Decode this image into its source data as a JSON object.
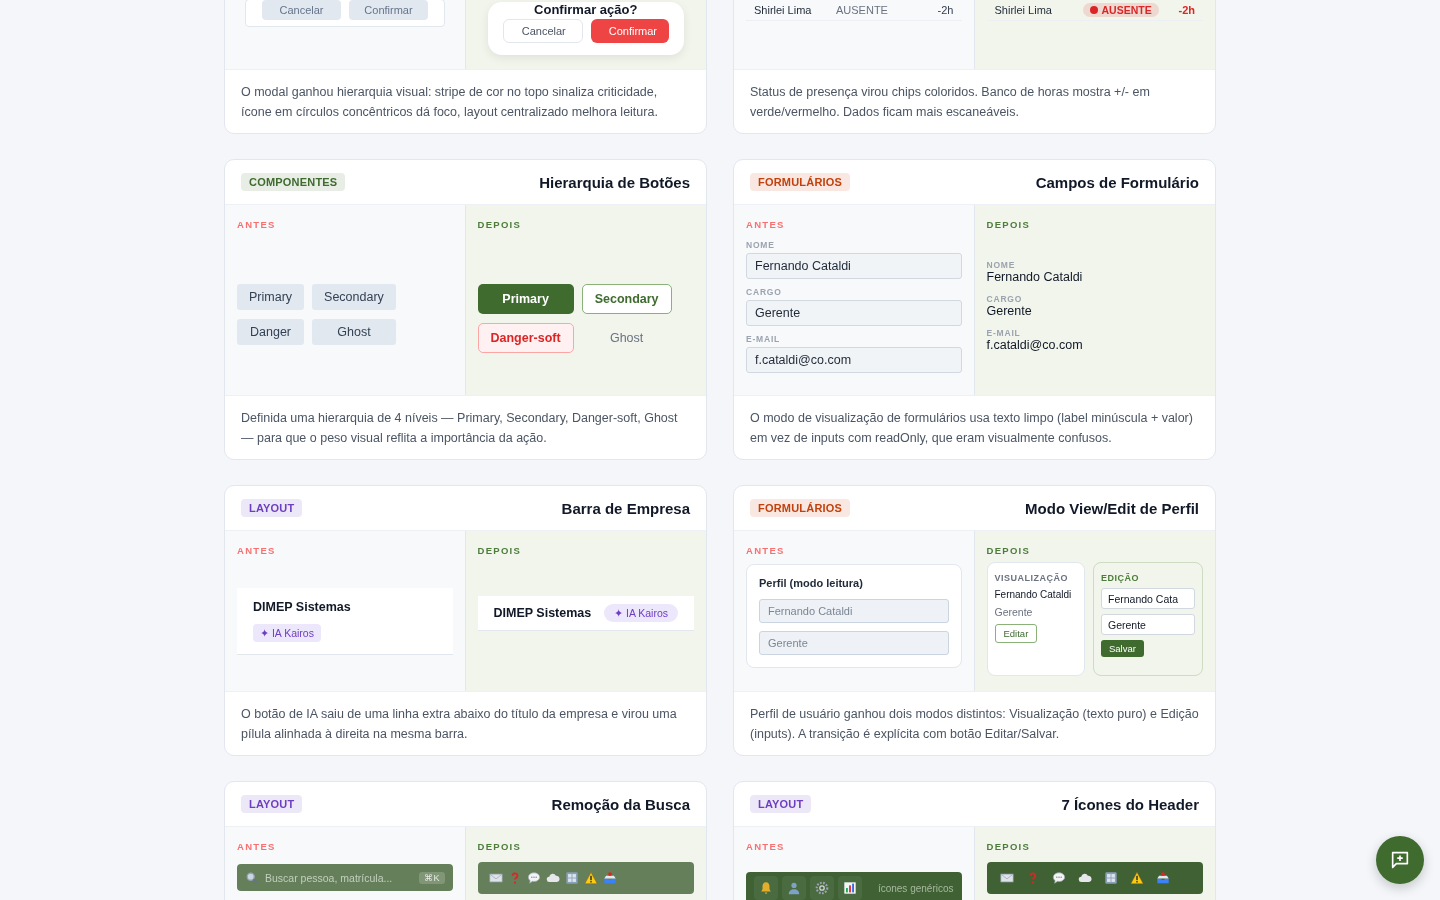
{
  "cards": [
    {
      "kind": "modal",
      "before": {
        "buttons": [
          "Cancelar",
          "Confirmar"
        ]
      },
      "after": {
        "title": "Confirmar ação?",
        "buttons": [
          {
            "text": "Cancelar",
            "kind": "outline"
          },
          {
            "text": "Confirmar",
            "kind": "danger"
          }
        ]
      },
      "description": "O modal ganhou hierarquia visual: stripe de cor no topo sinaliza criticidade, ícone em círculos concêntricos dá foco, layout centralizado melhora leitura."
    },
    {
      "kind": "presence",
      "before": {
        "rows": [
          {
            "name": "Shirlei Lima",
            "status": "AUSENTE",
            "hours": "-2h"
          }
        ]
      },
      "after": {
        "rows": [
          {
            "name": "Shirlei Lima",
            "status": {
              "text": "AUSENTE",
              "color": "#dc2626"
            },
            "hours": {
              "text": "-2h",
              "color": "#dc2626"
            }
          }
        ]
      },
      "description": "Status de presença virou chips coloridos. Banco de horas mostra +/- em verde/vermelho. Dados ficam mais escaneáveis."
    },
    {
      "kind": "buttons",
      "tag": {
        "text": "COMPONENTES",
        "color": "#3f6b2f"
      },
      "title": "Hierarquia de Botões",
      "before": {
        "label": "ANTES",
        "buttons": [
          "Primary",
          "Secondary",
          "Danger",
          "Ghost"
        ]
      },
      "after": {
        "label": "DEPOIS",
        "buttons": [
          {
            "text": "Primary",
            "kind": "primary"
          },
          {
            "text": "Secondary",
            "kind": "secondary"
          },
          {
            "text": "Danger-soft",
            "kind": "danger-soft"
          },
          {
            "text": "Ghost",
            "kind": "ghost"
          }
        ]
      },
      "description": "Definida uma hierarquia de 4 níveis — Primary, Secondary, Danger-soft, Ghost — para que o peso visual reflita a importância da ação."
    },
    {
      "kind": "form",
      "tag": {
        "text": "FORMULÁRIOS",
        "color": "#c2410c"
      },
      "title": "Campos de Formulário",
      "before": {
        "label": "ANTES",
        "fields": [
          {
            "label": "NOME",
            "value": "Fernando Cataldi"
          },
          {
            "label": "CARGO",
            "value": "Gerente"
          },
          {
            "label": "E-MAIL",
            "value": "f.cataldi@co.com"
          }
        ]
      },
      "after": {
        "label": "DEPOIS",
        "fields": [
          {
            "label": "NOME",
            "value": "Fernando Cataldi"
          },
          {
            "label": "CARGO",
            "value": "Gerente"
          },
          {
            "label": "E-MAIL",
            "value": "f.cataldi@co.com"
          }
        ]
      },
      "description": "O modo de visualização de formulários usa texto limpo (label minúscula + valor) em vez de inputs com readOnly, que eram visualmente confusos."
    },
    {
      "kind": "company",
      "tag": {
        "text": "LAYOUT",
        "color": "#6d3fc0"
      },
      "title": "Barra de Empresa",
      "before": {
        "label": "ANTES",
        "company": "DIMEP Sistemas",
        "ai": "✦ IA Kairos"
      },
      "after": {
        "label": "DEPOIS",
        "company": "DIMEP Sistemas",
        "ai": "✦ IA Kairos"
      },
      "description": "O botão de IA saiu de uma linha extra abaixo do título da empresa e virou uma pílula alinhada à direita na mesma barra."
    },
    {
      "kind": "profile",
      "tag": {
        "text": "FORMULÁRIOS",
        "color": "#c2410c"
      },
      "title": "Modo View/Edit de Perfil",
      "before": {
        "label": "ANTES",
        "heading": "Perfil (modo leitura)",
        "fields": [
          {
            "value": "Fernando Cataldi",
            "disabled": true
          },
          {
            "value": "Gerente",
            "disabled": true
          }
        ]
      },
      "after": {
        "label": "DEPOIS",
        "view": {
          "heading": "VISUALIZAÇÃO",
          "name": "Fernando Cataldi",
          "role": "Gerente",
          "button": "Editar"
        },
        "edit": {
          "heading": "EDIÇÃO",
          "fields": [
            {
              "value": "Fernando Cata",
              "disabled": false
            },
            {
              "value": "Gerente",
              "disabled": false
            }
          ],
          "button": "Salvar"
        }
      },
      "description": "Perfil de usuário ganhou dois modos distintos: Visualização (texto puro) e Edição (inputs). A transição é explícita com botão Editar/Salvar."
    },
    {
      "kind": "search",
      "tag": {
        "text": "LAYOUT",
        "color": "#6d3fc0"
      },
      "title": "Remoção da Busca",
      "before": {
        "label": "ANTES",
        "placeholder": "Buscar pessoa, matrícula...",
        "shortcut": "⌘K"
      },
      "after": {
        "label": "DEPOIS"
      }
    },
    {
      "kind": "icons",
      "tag": {
        "text": "LAYOUT",
        "color": "#6d3fc0"
      },
      "title": "7 Ícones do Header",
      "before": {
        "label": "ANTES",
        "note": "ícones genéricos"
      },
      "after": {
        "label": "DEPOIS"
      }
    }
  ]
}
